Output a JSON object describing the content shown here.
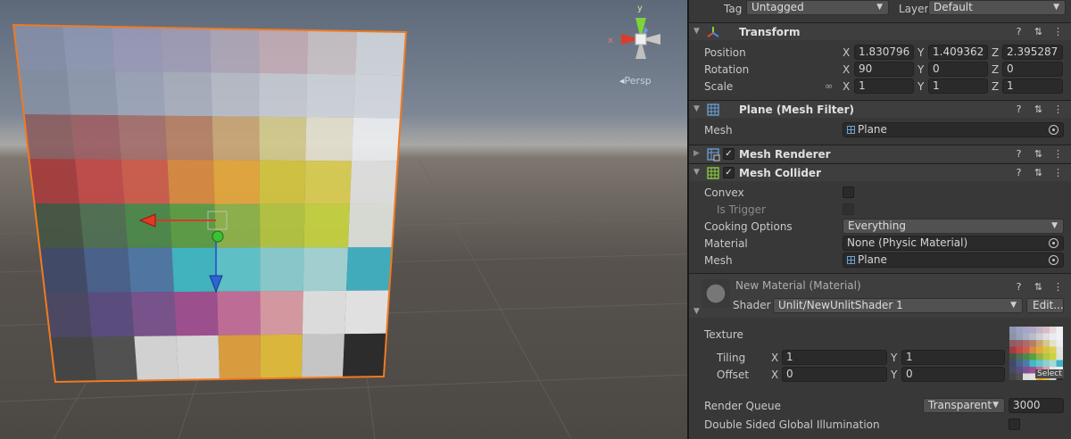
{
  "scene": {
    "orientation_gizmo": {
      "y_label": "y",
      "x_label": "x"
    },
    "projection_label": "Persp",
    "texture_palette": [
      [
        "#8f96b3",
        "#9aa1bf",
        "#a6a5c6",
        "#b0a9c5",
        "#c3b6c8",
        "#dcbcc4",
        "#e5d8d8",
        "#eef0f4"
      ],
      [
        "#8894a8",
        "#96a2b6",
        "#a8afc3",
        "#b9bccb",
        "#ccced7",
        "#dedfe4",
        "#e9ebef",
        "#f0f1f5"
      ],
      [
        "#8b5f61",
        "#9c6064",
        "#a56f6d",
        "#b58064",
        "#c8a574",
        "#d3c98b",
        "#e4e0cd",
        "#eceef0"
      ],
      [
        "#a63c3d",
        "#c24a48",
        "#cf5c4c",
        "#d98a40",
        "#e5a83c",
        "#d4c640",
        "#dccf53",
        "#e3e3e3"
      ],
      [
        "#455544",
        "#4f7053",
        "#4c8a4a",
        "#5c9e45",
        "#8fb44a",
        "#b6c741",
        "#c7d43f",
        "#dfe2dc"
      ],
      [
        "#3f4a69",
        "#49628f",
        "#4f79a8",
        "#3fbac7",
        "#5fc7cf",
        "#8bd0d3",
        "#a7d8d9",
        "#3fb2c5"
      ],
      [
        "#4b4866",
        "#5a4e82",
        "#7a5390",
        "#a05092",
        "#c56f9b",
        "#dd9ea6",
        "#e6e6e6",
        "#ececec"
      ],
      [
        "#454545",
        "#525252",
        "#dcdcdc",
        "#e0e0e0",
        "#e2a23e",
        "#e4bf3a",
        "#cfcfcf",
        "#2a2a2a"
      ]
    ]
  },
  "inspector": {
    "tag": {
      "label": "Tag",
      "value": "Untagged"
    },
    "layer": {
      "label": "Layer",
      "value": "Default"
    },
    "transform": {
      "title": "Transform",
      "position": {
        "label": "Position",
        "x": "1.830796",
        "y": "1.409362",
        "z": "2.395287"
      },
      "rotation": {
        "label": "Rotation",
        "x": "90",
        "y": "0",
        "z": "0"
      },
      "scale": {
        "label": "Scale",
        "x": "1",
        "y": "1",
        "z": "1"
      },
      "axis_x": "X",
      "axis_y": "Y",
      "axis_z": "Z"
    },
    "mesh_filter": {
      "title": "Plane (Mesh Filter)",
      "mesh_label": "Mesh",
      "mesh_value": "Plane"
    },
    "mesh_renderer": {
      "title": "Mesh Renderer"
    },
    "mesh_collider": {
      "title": "Mesh Collider",
      "convex_label": "Convex",
      "is_trigger_label": "Is Trigger",
      "cooking_label": "Cooking Options",
      "cooking_value": "Everything",
      "material_label": "Material",
      "material_value": "None (Physic Material)",
      "mesh_label": "Mesh",
      "mesh_value": "Plane"
    },
    "material": {
      "title": "New Material (Material)",
      "shader_label": "Shader",
      "shader_value": "Unlit/NewUnlitShader 1",
      "edit_label": "Edit...",
      "texture_label": "Texture",
      "tiling_label": "Tiling",
      "tiling_x": "1",
      "tiling_y": "1",
      "offset_label": "Offset",
      "offset_x": "0",
      "offset_y": "0",
      "select_label": "Select",
      "render_queue_label": "Render Queue",
      "render_queue_mode": "Transparent",
      "render_queue_value": "3000",
      "dsgi_label": "Double Sided Global Illumination",
      "axis_x": "X",
      "axis_y": "Y"
    }
  }
}
